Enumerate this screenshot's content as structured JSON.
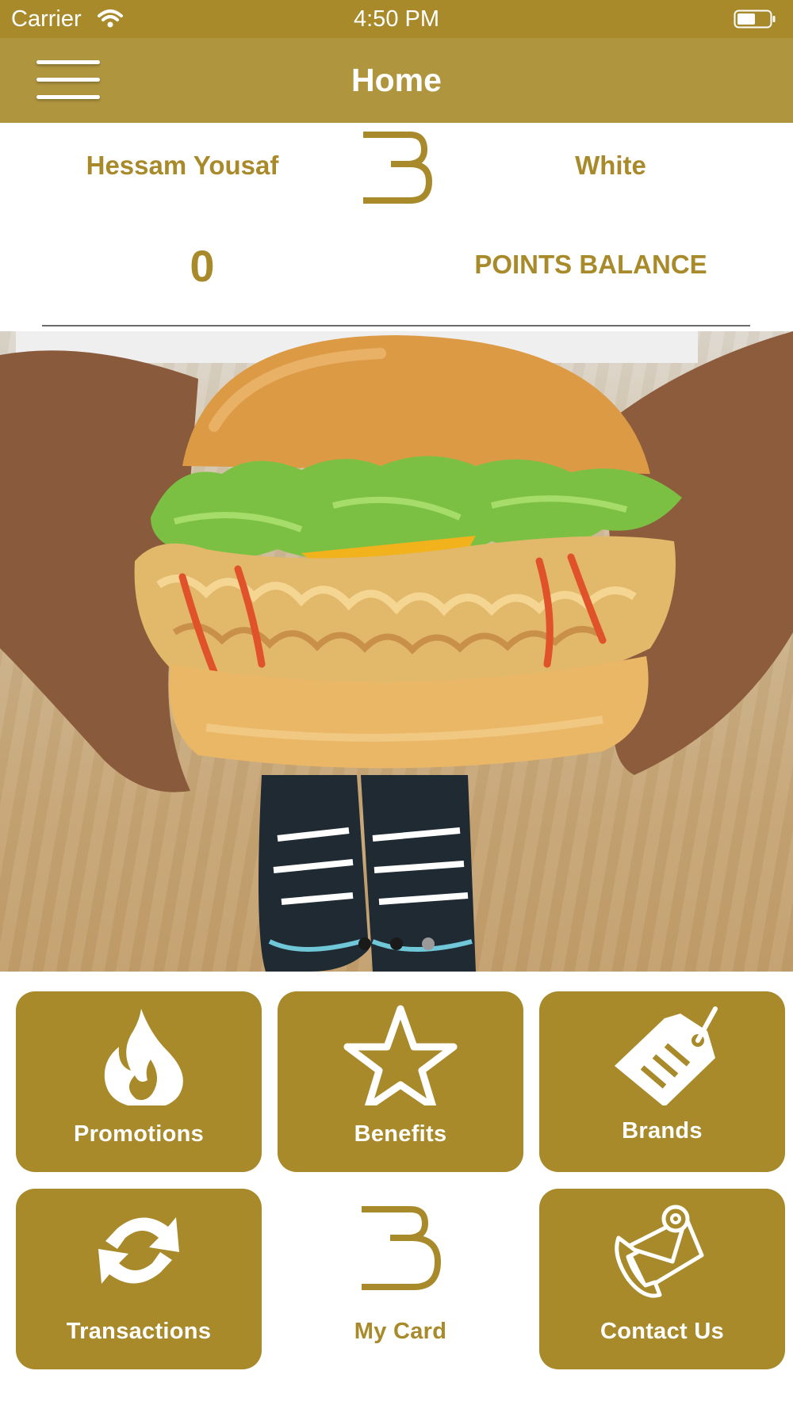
{
  "status_bar": {
    "carrier": "Carrier",
    "time": "4:50 PM"
  },
  "nav": {
    "title": "Home",
    "menu_icon": "hamburger-menu-icon"
  },
  "profile": {
    "name": "Hessam Yousaf",
    "tier": "White",
    "points": "0",
    "points_label": "POINTS BALANCE"
  },
  "banner": {
    "description_icon": "burger-photo",
    "page_count": 3,
    "active_page": 2
  },
  "tiles": [
    {
      "label": "Promotions",
      "icon": "flame-icon"
    },
    {
      "label": "Benefits",
      "icon": "star-icon"
    },
    {
      "label": "Brands",
      "icon": "tag-icon"
    },
    {
      "label": "Transactions",
      "icon": "refresh-arrows-icon"
    },
    {
      "label": "My Card",
      "icon": "brand-logo-icon"
    },
    {
      "label": "Contact Us",
      "icon": "contact-envelope-icon"
    }
  ],
  "colors": {
    "brand_gold": "#a88a2b",
    "nav_gold": "#b0953f",
    "white": "#ffffff"
  }
}
